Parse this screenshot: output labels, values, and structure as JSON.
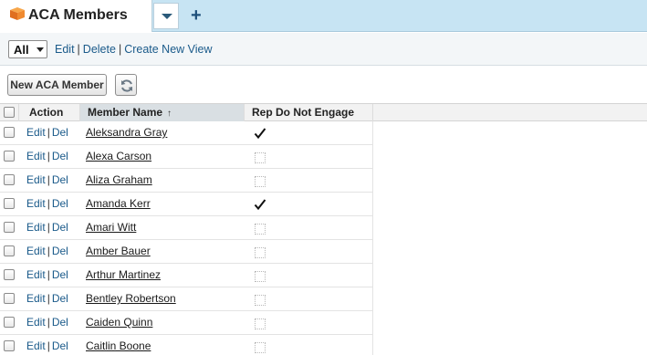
{
  "tab": {
    "title": "ACA Members",
    "icon": "cube-icon",
    "add_label": "+"
  },
  "view": {
    "selected": "All",
    "links": [
      "Edit",
      "Delete",
      "Create New View"
    ]
  },
  "toolbar": {
    "new_label": "New ACA Member",
    "refresh_icon": "refresh-icon"
  },
  "grid": {
    "headers": {
      "action": "Action",
      "member_name": "Member Name",
      "rep_do_not_engage": "Rep Do Not Engage"
    },
    "sort_indicator": "↑",
    "edit_label": "Edit",
    "del_label": "Del",
    "rows": [
      {
        "name": "Aleksandra Gray",
        "rep_do_not_engage": true
      },
      {
        "name": "Alexa Carson",
        "rep_do_not_engage": false
      },
      {
        "name": "Aliza Graham",
        "rep_do_not_engage": false
      },
      {
        "name": "Amanda Kerr",
        "rep_do_not_engage": true
      },
      {
        "name": "Amari Witt",
        "rep_do_not_engage": false
      },
      {
        "name": "Amber Bauer",
        "rep_do_not_engage": false
      },
      {
        "name": "Arthur Martinez",
        "rep_do_not_engage": false
      },
      {
        "name": "Bentley Robertson",
        "rep_do_not_engage": false
      },
      {
        "name": "Caiden Quinn",
        "rep_do_not_engage": false
      },
      {
        "name": "Caitlin Boone",
        "rep_do_not_engage": false
      }
    ]
  },
  "colors": {
    "tab_bar": "#c7e4f3",
    "link": "#1a5a8a",
    "sorted_column": "#d9dfe3"
  }
}
